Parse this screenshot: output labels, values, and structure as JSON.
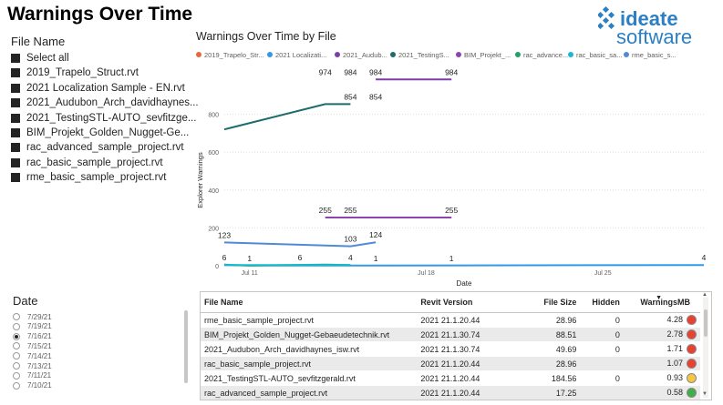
{
  "header": {
    "title": "Warnings Over Time"
  },
  "logo": {
    "line1": "ideate",
    "line2": "software",
    "color": "#2b7fc4"
  },
  "file_slicer": {
    "title": "File Name",
    "items": [
      "Select all",
      "2019_Trapelo_Struct.rvt",
      "2021 Localization Sample - EN.rvt",
      "2021_Audubon_Arch_davidhaynes...",
      "2021_TestingSTL-AUTO_sevfitzge...",
      "BIM_Projekt_Golden_Nugget-Ge...",
      "rac_advanced_sample_project.rvt",
      "rac_basic_sample_project.rvt",
      "rme_basic_sample_project.rvt"
    ]
  },
  "date_slicer": {
    "title": "Date",
    "items": [
      "7/29/21",
      "7/19/21",
      "7/16/21",
      "7/15/21",
      "7/14/21",
      "7/13/21",
      "7/11/21",
      "7/10/21"
    ],
    "selected": "7/16/21"
  },
  "chart_data": {
    "type": "line",
    "title": "Warnings Over Time by File",
    "xlabel": "Date",
    "ylabel": "Explorer Warnings",
    "x_tick_labels": [
      "Jul 11",
      "Jul 18",
      "Jul 25"
    ],
    "y_tick_labels": [
      "0",
      "200",
      "400",
      "600",
      "800"
    ],
    "ylim": [
      0,
      1000
    ],
    "legend_position": "top",
    "series": [
      {
        "name": "2019_Trapelo_Str...",
        "color": "#e8663a",
        "points": []
      },
      {
        "name": "2021 Localizati...",
        "color": "#3399e6",
        "points": [
          [
            "2021-07-10",
            4
          ],
          [
            "2021-07-11",
            1
          ],
          [
            "2021-07-14",
            1
          ],
          [
            "2021-07-15",
            1
          ],
          [
            "2021-07-16",
            1
          ],
          [
            "2021-07-29",
            4
          ]
        ]
      },
      {
        "name": "2021_Audub...",
        "color": "#7b3fa8",
        "points": [
          [
            "2021-07-16",
            984
          ],
          [
            "2021-07-19",
            984
          ]
        ]
      },
      {
        "name": "2021_TestingS...",
        "color": "#1e6b6b",
        "points": [
          [
            "2021-07-10",
            720
          ],
          [
            "2021-07-14",
            854
          ],
          [
            "2021-07-15",
            854
          ]
        ]
      },
      {
        "name": "BIM_Projekt_...",
        "color": "#8e44ad",
        "points": [
          [
            "2021-07-14",
            255
          ],
          [
            "2021-07-15",
            255
          ],
          [
            "2021-07-19",
            255
          ]
        ]
      },
      {
        "name": "rac_advance...",
        "color": "#21a366",
        "points": [
          [
            "2021-07-10",
            6
          ],
          [
            "2021-07-11",
            1
          ],
          [
            "2021-07-14",
            6
          ],
          [
            "2021-07-15",
            4
          ]
        ]
      },
      {
        "name": "rac_basic_sa...",
        "color": "#17b8d6",
        "points": [
          [
            "2021-07-10",
            4
          ],
          [
            "2021-07-15",
            4
          ]
        ]
      },
      {
        "name": "rme_basic_s...",
        "color": "#4f8ad9",
        "points": [
          [
            "2021-07-10",
            123
          ],
          [
            "2021-07-15",
            103
          ],
          [
            "2021-07-16",
            124
          ]
        ]
      }
    ],
    "data_labels": [
      {
        "text": "974",
        "x": "2021-07-14",
        "y": 984
      },
      {
        "text": "984",
        "x": "2021-07-15",
        "y": 984
      },
      {
        "text": "984",
        "x": "2021-07-16",
        "y": 984
      },
      {
        "text": "984",
        "x": "2021-07-19",
        "y": 984
      },
      {
        "text": "854",
        "x": "2021-07-15",
        "y": 854
      },
      {
        "text": "854",
        "x": "2021-07-16",
        "y": 854
      },
      {
        "text": "255",
        "x": "2021-07-14",
        "y": 255
      },
      {
        "text": "255",
        "x": "2021-07-15",
        "y": 255
      },
      {
        "text": "255",
        "x": "2021-07-19",
        "y": 255
      },
      {
        "text": "123",
        "x": "2021-07-10",
        "y": 123
      },
      {
        "text": "103",
        "x": "2021-07-15",
        "y": 103
      },
      {
        "text": "124",
        "x": "2021-07-16",
        "y": 124
      },
      {
        "text": "6",
        "x": "2021-07-10",
        "y": 6
      },
      {
        "text": "1",
        "x": "2021-07-11",
        "y": 1
      },
      {
        "text": "6",
        "x": "2021-07-13",
        "y": 6
      },
      {
        "text": "4",
        "x": "2021-07-15",
        "y": 4
      },
      {
        "text": "1",
        "x": "2021-07-16",
        "y": 1
      },
      {
        "text": "1",
        "x": "2021-07-19",
        "y": 1
      },
      {
        "text": "4",
        "x": "2021-07-29",
        "y": 4
      }
    ]
  },
  "table": {
    "columns": [
      "File Name",
      "Revit Version",
      "File Size",
      "Hidden",
      "WarningsMB"
    ],
    "rows": [
      {
        "file": "rme_basic_sample_project.rvt",
        "version": "2021 21.1.20.44",
        "size": "28.96",
        "hidden": "0",
        "wmb": "4.28",
        "status": "#e8412f"
      },
      {
        "file": "BIM_Projekt_Golden_Nugget-Gebaeudetechnik.rvt",
        "version": "2021 21.1.30.74",
        "size": "88.51",
        "hidden": "0",
        "wmb": "2.78",
        "status": "#e8412f"
      },
      {
        "file": "2021_Audubon_Arch_davidhaynes_isw.rvt",
        "version": "2021 21.1.30.74",
        "size": "49.69",
        "hidden": "0",
        "wmb": "1.71",
        "status": "#e8412f"
      },
      {
        "file": "rac_basic_sample_project.rvt",
        "version": "2021 21.1.20.44",
        "size": "28.96",
        "hidden": "",
        "wmb": "1.07",
        "status": "#e8412f"
      },
      {
        "file": "2021_TestingSTL-AUTO_sevfitzgerald.rvt",
        "version": "2021 21.1.20.44",
        "size": "184.56",
        "hidden": "0",
        "wmb": "0.93",
        "status": "#f2c744"
      },
      {
        "file": "rac_advanced_sample_project.rvt",
        "version": "2021 21.1.20.44",
        "size": "17.25",
        "hidden": "",
        "wmb": "0.58",
        "status": "#3fae49"
      }
    ]
  }
}
